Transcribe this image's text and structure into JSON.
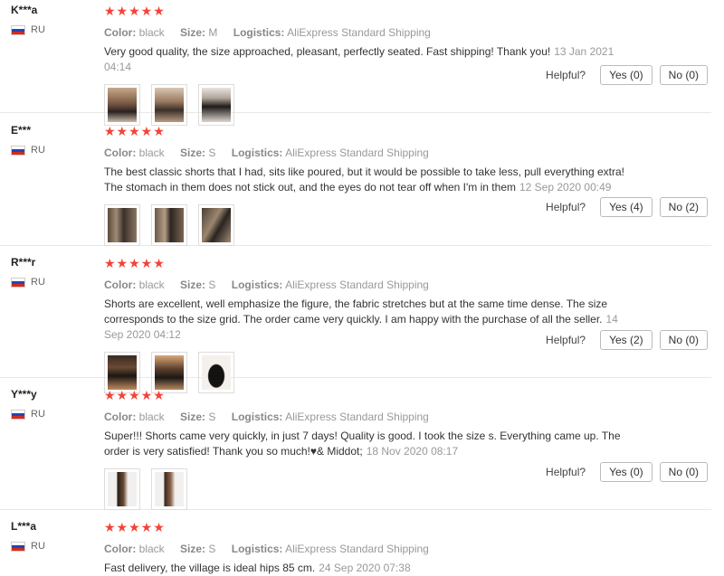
{
  "labels": {
    "color": "Color:",
    "size": "Size:",
    "logistics": "Logistics:",
    "helpful": "Helpful?"
  },
  "colors": {
    "star": "#f44336",
    "flag": [
      "#ffffff",
      "#1f47b4",
      "#d52b1e"
    ]
  },
  "reviews": [
    {
      "user": "K***a",
      "country": "RU",
      "stars": "★★★★★",
      "color": "black",
      "size": "M",
      "logistics": "AliExpress Standard Shipping",
      "text": "Very good quality, the size approached, pleasant, perfectly seated. Fast shipping! Thank you!",
      "date": "13 Jan 2021 04:14",
      "yes": "Yes (0)",
      "no": "No (0)"
    },
    {
      "user": "E***",
      "country": "RU",
      "stars": "★★★★★",
      "color": "black",
      "size": "S",
      "logistics": "AliExpress Standard Shipping",
      "text": "The best classic shorts that I had, sits like poured, but it would be possible to take less, pull everything extra! The stomach in them does not stick out, and the eyes do not tear off when I'm in them",
      "date": "12 Sep 2020 00:49",
      "yes": "Yes (4)",
      "no": "No (2)"
    },
    {
      "user": "R***r",
      "country": "RU",
      "stars": "★★★★★",
      "color": "black",
      "size": "S",
      "logistics": "AliExpress Standard Shipping",
      "text": "Shorts are excellent, well emphasize the figure, the fabric stretches but at the same time dense. The size corresponds to the size grid. The order came very quickly. I am happy with the purchase of all the seller.",
      "date": "14 Sep 2020 04:12",
      "yes": "Yes (2)",
      "no": "No (0)"
    },
    {
      "user": "Y***y",
      "country": "RU",
      "stars": "★★★★★",
      "color": "black",
      "size": "S",
      "logistics": "AliExpress Standard Shipping",
      "text": "Super!!! Shorts came very quickly, in just 7 days! Quality is good. I took the size s. Everything came up. The order is very satisfied! Thank you so much!♥& Middot;",
      "date": "18 Nov 2020 08:17",
      "yes": "Yes (0)",
      "no": "No (0)"
    },
    {
      "user": "L***a",
      "country": "RU",
      "stars": "★★★★★",
      "color": "black",
      "size": "S",
      "logistics": "AliExpress Standard Shipping",
      "text": "Fast delivery, the village is ideal hips 85 cm.",
      "date": "24 Sep 2020 07:38"
    }
  ]
}
